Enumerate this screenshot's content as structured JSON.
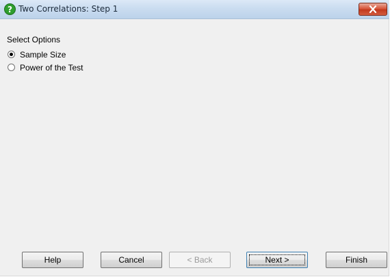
{
  "window": {
    "title": "Two Correlations: Step 1",
    "icon": "help-question-icon",
    "close_icon": "close-x-icon"
  },
  "options": {
    "group_label": "Select Options",
    "items": [
      {
        "label": "Sample Size",
        "selected": true
      },
      {
        "label": "Power of the Test",
        "selected": false
      }
    ]
  },
  "buttons": {
    "help": "Help",
    "cancel": "Cancel",
    "back": "< Back",
    "next": "Next >",
    "finish": "Finish"
  },
  "colors": {
    "close_button": "#c83a1e",
    "help_icon": "#2e9e2e"
  }
}
